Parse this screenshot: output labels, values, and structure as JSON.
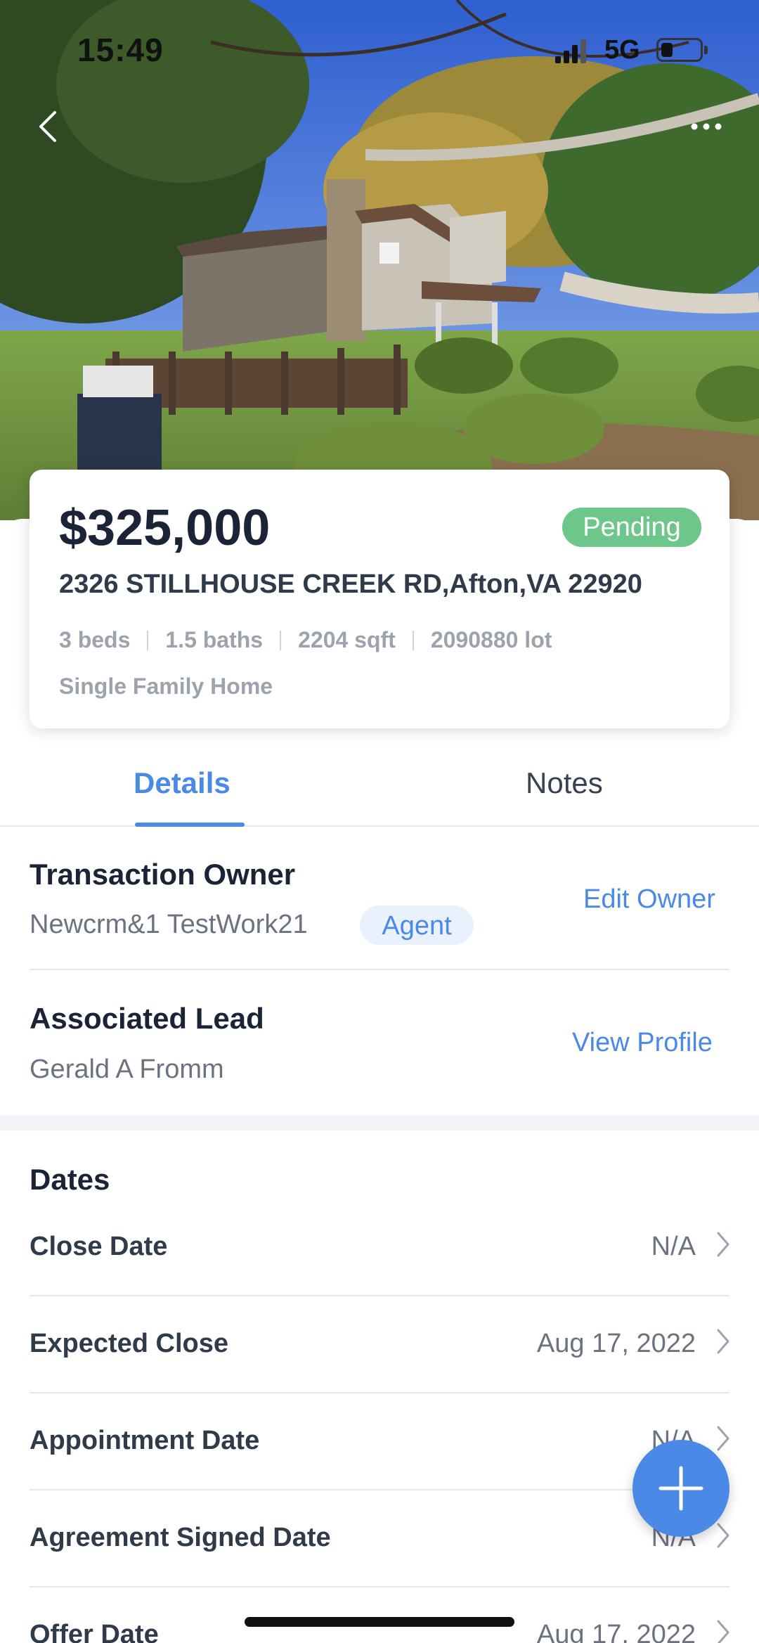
{
  "status_bar": {
    "time": "15:49",
    "network": "5G"
  },
  "listing": {
    "price": "$325,000",
    "status": "Pending",
    "address": "2326 STILLHOUSE CREEK RD,Afton,VA 22920",
    "beds": "3 beds",
    "baths": "1.5 baths",
    "sqft": "2204 sqft",
    "lot": "2090880 lot",
    "home_type": "Single Family Home"
  },
  "tabs": [
    {
      "label": "Details",
      "active": true
    },
    {
      "label": "Notes",
      "active": false
    }
  ],
  "transaction_owner": {
    "title": "Transaction Owner",
    "name": "Newcrm&1 TestWork21",
    "role": "Agent",
    "action": "Edit Owner"
  },
  "associated_lead": {
    "title": "Associated Lead",
    "name": "Gerald A Fromm",
    "action": "View Profile"
  },
  "dates": {
    "title": "Dates",
    "rows": [
      {
        "label": "Close Date",
        "value": "N/A"
      },
      {
        "label": "Expected Close",
        "value": "Aug 17, 2022"
      },
      {
        "label": "Appointment Date",
        "value": "N/A"
      },
      {
        "label": "Agreement Signed Date",
        "value": "N/A"
      },
      {
        "label": "Offer Date",
        "value": "Aug 17, 2022"
      }
    ]
  },
  "icons": {
    "back": "chevron-left-icon",
    "more": "ellipsis-icon",
    "fab": "plus-icon",
    "row": "chevron-right-icon"
  },
  "colors": {
    "accent": "#4a8ae6",
    "pending": "#6dc68a",
    "text_dark": "#1b2437",
    "text_muted": "#6b7280"
  }
}
